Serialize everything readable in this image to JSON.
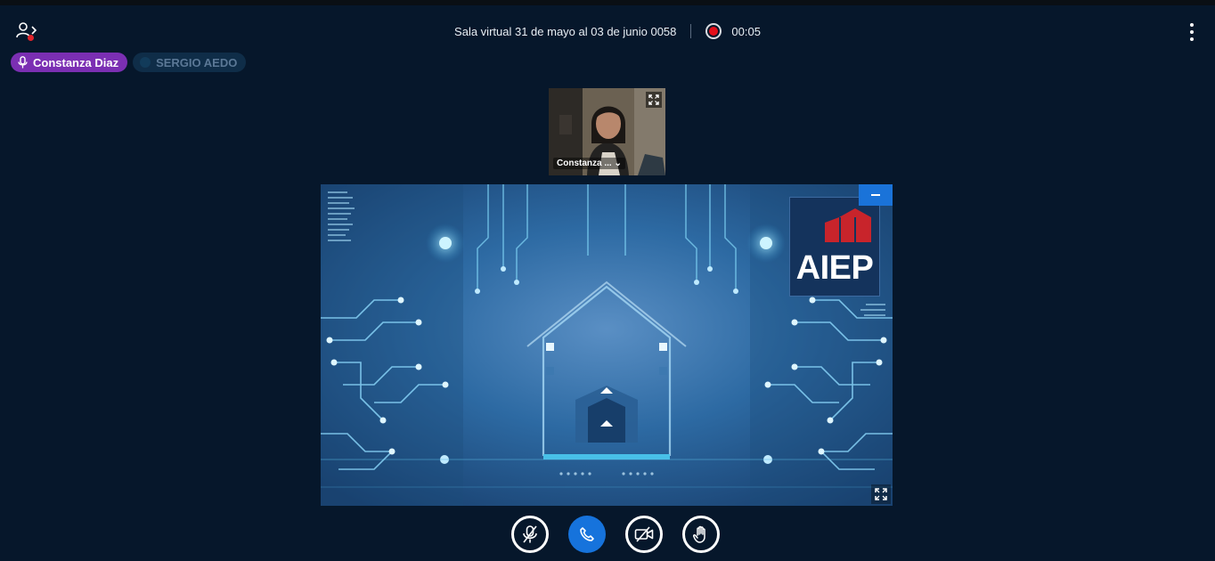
{
  "header": {
    "room_title": "Sala virtual 31 de mayo al 03 de junio 0058",
    "recording_time": "00:05",
    "record_color": "#e3101b"
  },
  "talkers": [
    {
      "name": "Constanza Diaz",
      "state": "talking",
      "icon": "microphone-icon",
      "color": "#7b2fb3"
    },
    {
      "name": "SERGIO AEDO",
      "state": "idle",
      "color": "#0f2d48"
    }
  ],
  "webcam": {
    "user_name": "Constanza ..."
  },
  "presentation": {
    "logo_text": "AIEP",
    "logo_color": "#14335c",
    "accent_red": "#c8242b"
  },
  "controls": {
    "buttons": [
      "mute-microphone-icon",
      "phone-icon",
      "video-off-icon",
      "raise-hand-icon"
    ],
    "accent": "#1673dc"
  }
}
